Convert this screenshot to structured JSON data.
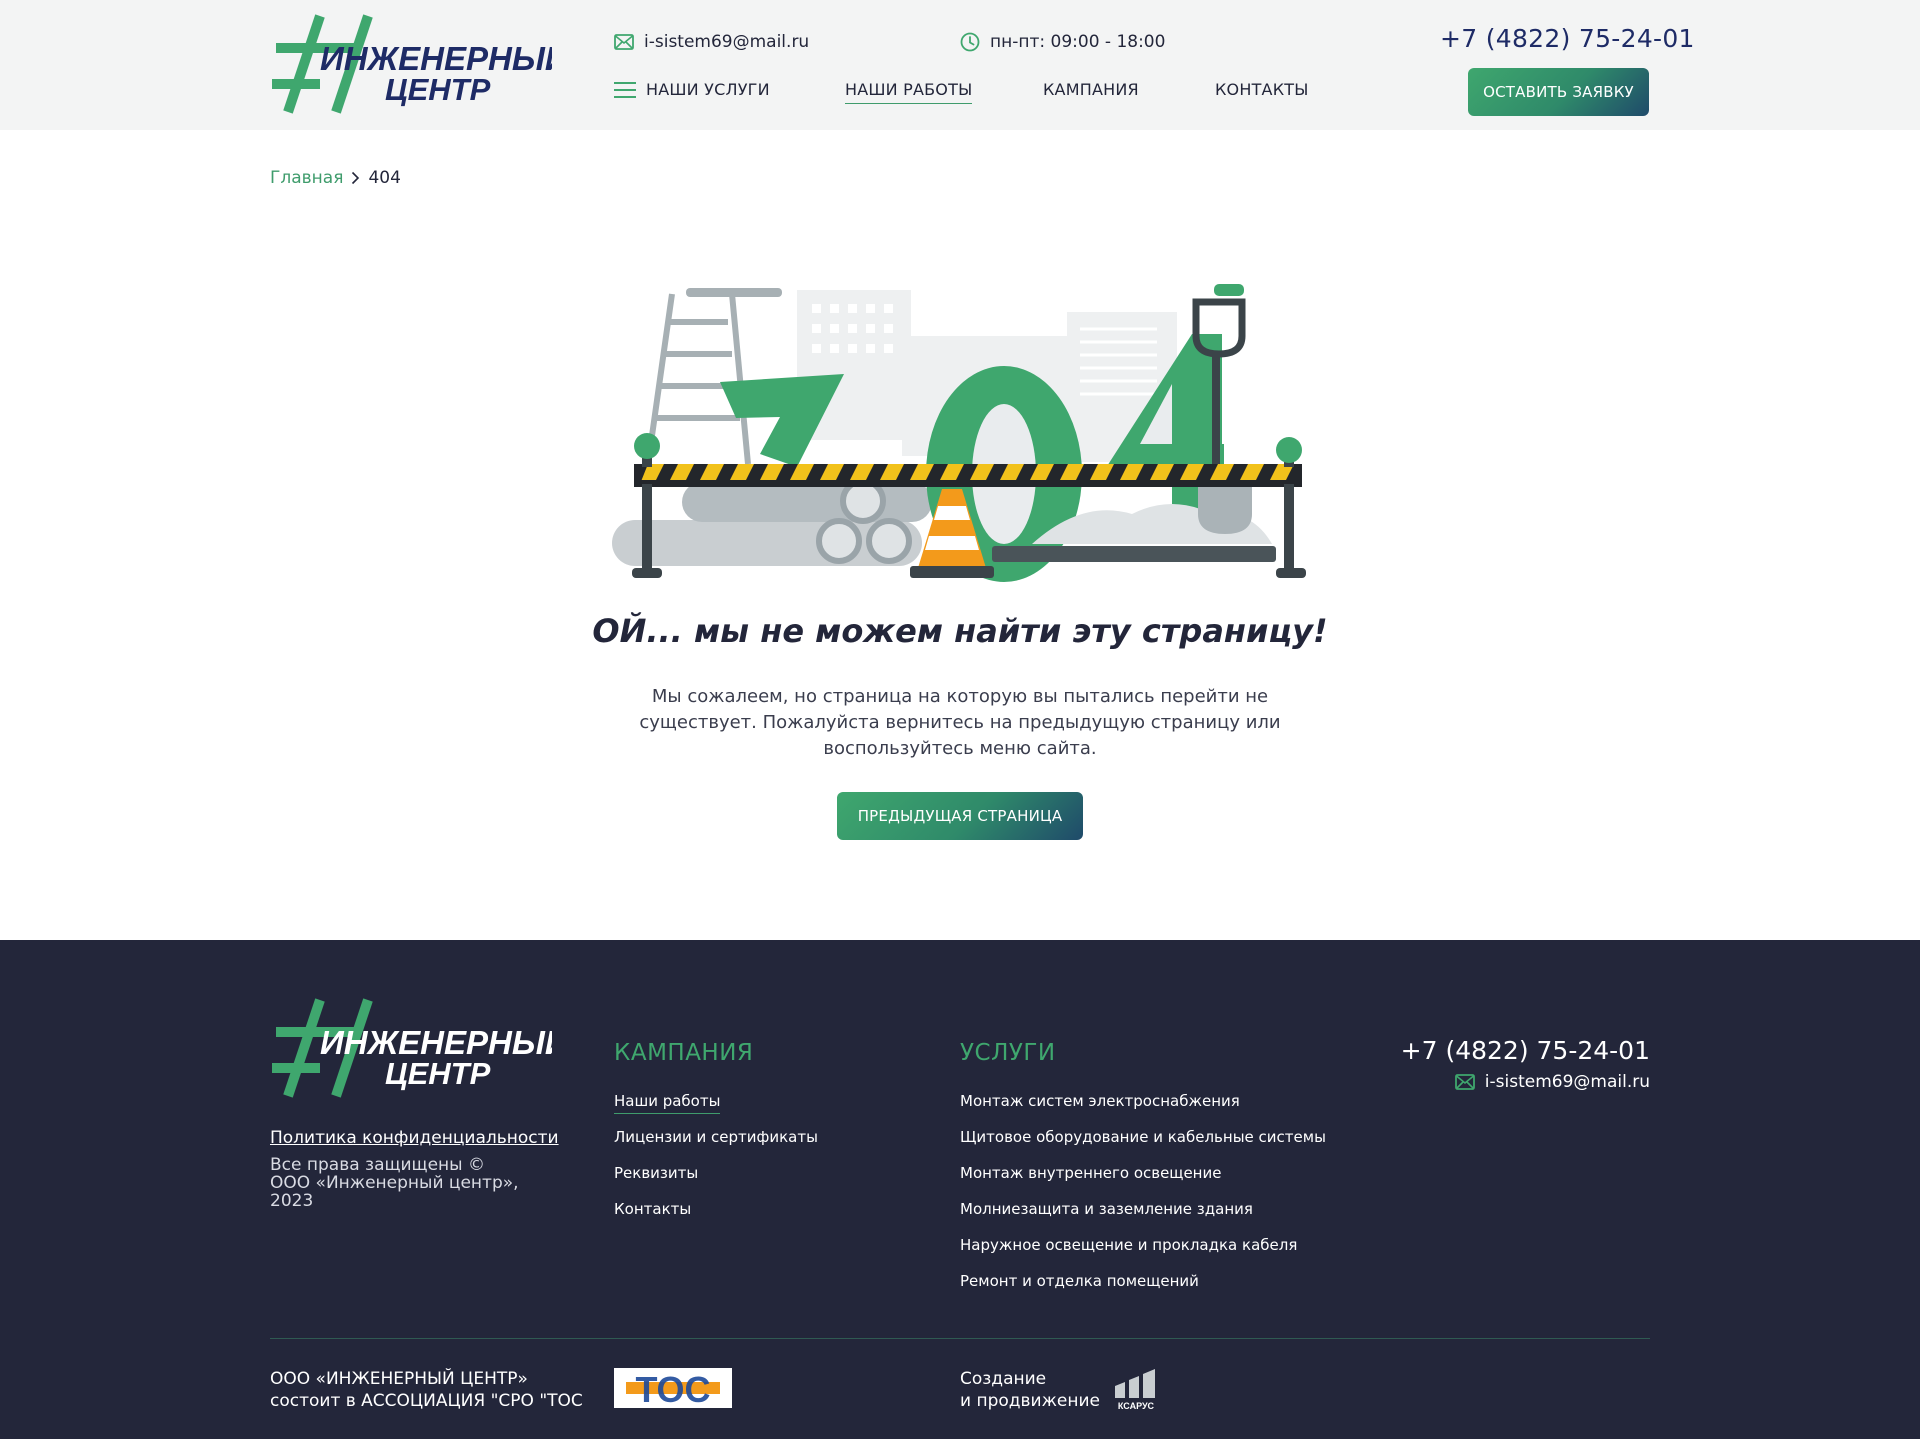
{
  "header": {
    "logo_line1": "ИНЖЕНЕРНЫЙ",
    "logo_line2": "ЦЕНТР",
    "email": "i-sistem69@mail.ru",
    "hours": "пн-пт: 09:00 - 18:00",
    "phone": "+7 (4822) 75-24-01",
    "nav": {
      "services": "НАШИ УСЛУГИ",
      "works": "НАШИ РАБОТЫ",
      "company": "КАМПАНИЯ",
      "contacts": "КОНТАКТЫ"
    },
    "request_button": "ОСТАВИТЬ ЗАЯВКУ"
  },
  "breadcrumb": {
    "home": "Главная",
    "current": "404"
  },
  "error": {
    "code": "404",
    "title": "ОЙ... мы не можем найти эту страницу!",
    "text": "Мы сожалеем, но страница на которую вы пытались перейти не существует. Пожалуйста вернитесь на предыдущую страницу или воспользуйтесь меню сайта.",
    "button": "ПРЕДЫДУЩАЯ СТРАНИЦА"
  },
  "footer": {
    "logo_line1": "ИНЖЕНЕРНЫЙ",
    "logo_line2": "ЦЕНТР",
    "privacy": "Политика конфиденциальности",
    "copyright": "Все права защищены © ООО «Инженерный центр», 2023",
    "company_title": "КАМПАНИЯ",
    "company_links": [
      "Наши работы",
      "Лицензии и сертификаты",
      "Реквизиты",
      "Контакты"
    ],
    "services_title": "УСЛУГИ",
    "services_links": [
      "Монтаж систем электроснабжения",
      "Щитовое оборудование и кабельные системы",
      "Монтаж внутреннего освещение",
      "Молниезащита и заземление здания",
      "Наружное освещение и прокладка кабеля",
      "Ремонт и отделка помещений"
    ],
    "phone": "+7 (4822) 75-24-01",
    "email": "i-sistem69@mail.ru",
    "org_line1": "ООО «ИНЖЕНЕРНЫЙ ЦЕНТР»",
    "org_line2": "состоит в АССОЦИАЦИЯ \"СРО \"ТОС",
    "tos_logo_text": "ТОС",
    "made_line1": "Создание",
    "made_line2": "и продвижение",
    "ksarus_text": "КСАРУС"
  },
  "colors": {
    "accent_green": "#3fa76e",
    "navy": "#1e2b66",
    "footer_bg": "#23263a",
    "header_bg": "#f3f4f4"
  }
}
